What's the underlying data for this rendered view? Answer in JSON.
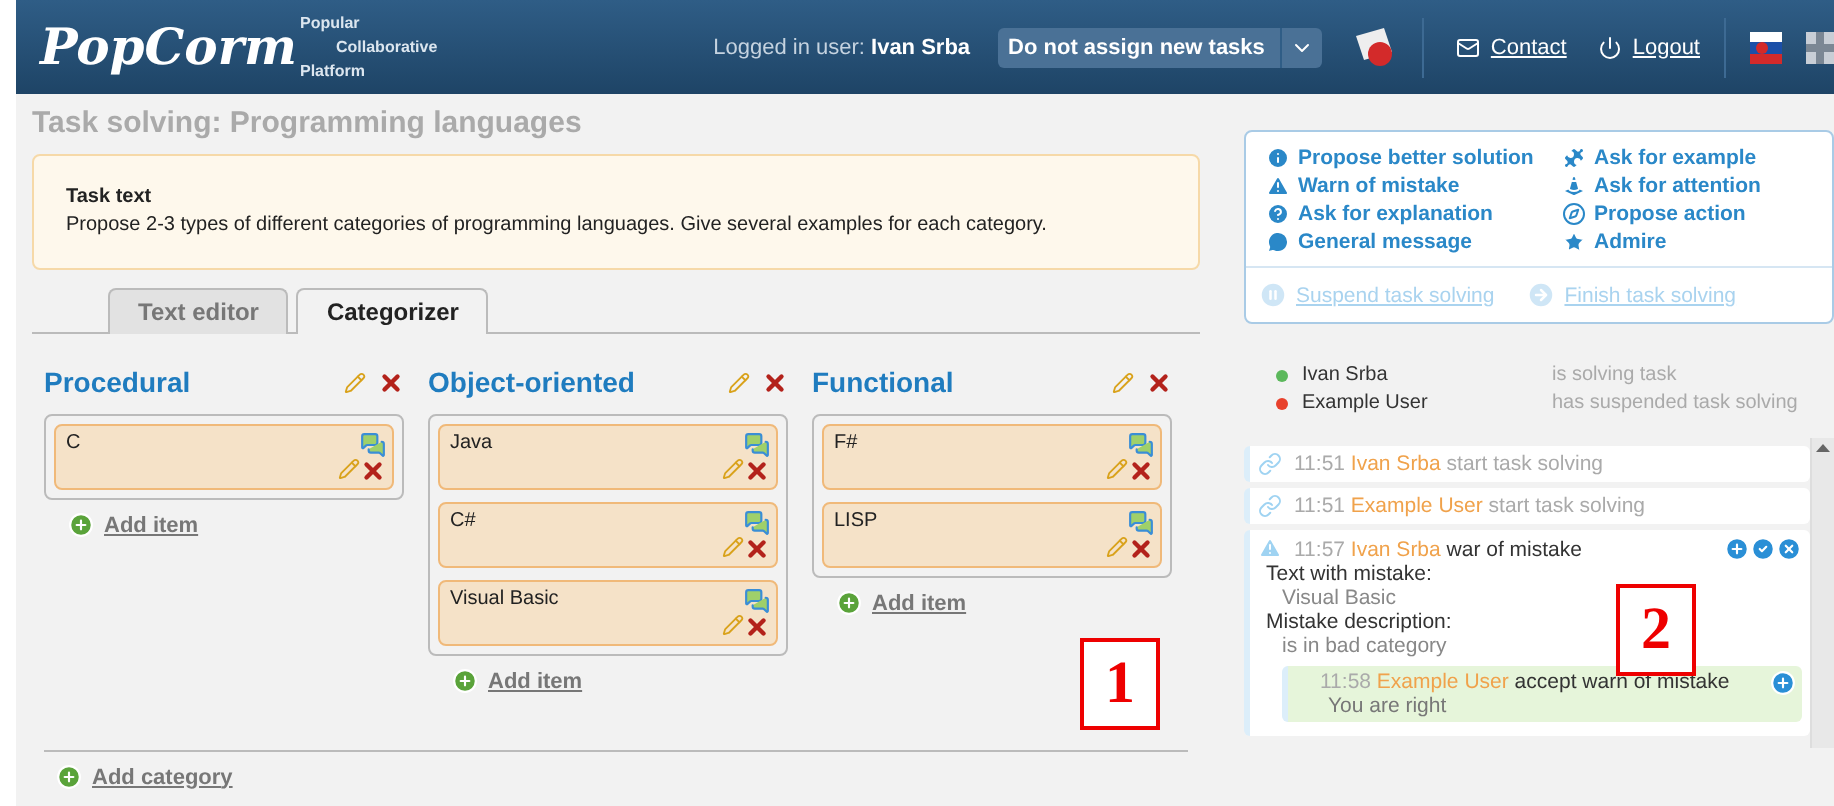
{
  "header": {
    "logo": "PopCorm",
    "tagline": [
      "Popular",
      "Collaborative",
      "Platform"
    ],
    "login_label": "Logged in user:",
    "user": "Ivan Srba",
    "mode_select": {
      "value": "Do not assign new tasks"
    },
    "links": [
      {
        "kind": "contact",
        "label": "Contact"
      },
      {
        "kind": "logout",
        "label": "Logout"
      }
    ]
  },
  "page_title": "Task solving: Programming languages",
  "task": {
    "heading": "Task text",
    "text": "Propose 2-3 types of different categories of programming languages. Give several examples for each category."
  },
  "tabs": [
    {
      "label": "Text editor",
      "selected": false
    },
    {
      "label": "Categorizer",
      "selected": true
    }
  ],
  "categories": [
    {
      "name": "Procedural",
      "items": [
        "C"
      ],
      "add_label": "Add item"
    },
    {
      "name": "Object-oriented",
      "items": [
        "Java",
        "C#",
        "Visual Basic"
      ],
      "add_label": "Add item"
    },
    {
      "name": "Functional",
      "items": [
        "F#",
        "LISP"
      ],
      "add_label": "Add item"
    }
  ],
  "add_category": "Add category",
  "actions": [
    {
      "kind": "info",
      "label": "Propose better solution"
    },
    {
      "kind": "example",
      "label": "Ask for example"
    },
    {
      "kind": "warning",
      "label": "Warn of mistake"
    },
    {
      "kind": "attention",
      "label": "Ask for attention"
    },
    {
      "kind": "question",
      "label": "Ask for explanation"
    },
    {
      "kind": "action",
      "label": "Propose action"
    },
    {
      "kind": "message",
      "label": "General message"
    },
    {
      "kind": "admire",
      "label": "Admire"
    }
  ],
  "task_controls": [
    {
      "kind": "suspend",
      "label": "Suspend task solving",
      "disabled": true
    },
    {
      "kind": "finish",
      "label": "Finish task solving",
      "disabled": true
    }
  ],
  "participants": [
    {
      "name": "Ivan Srba",
      "status": "is solving task",
      "color": "#5cb85c"
    },
    {
      "name": "Example User",
      "status": "has suspended task solving",
      "color": "#e8412c"
    }
  ],
  "log": [
    {
      "kind": "start",
      "time": "11:51",
      "user": "Ivan Srba",
      "text": "start task solving"
    },
    {
      "kind": "start",
      "time": "11:51",
      "user": "Example User",
      "text": "start task solving"
    },
    {
      "kind": "warning",
      "time": "11:57",
      "user": "Ivan Srba",
      "text": "war of mistake",
      "details": [
        {
          "label": "Text with mistake:",
          "value": "Visual Basic"
        },
        {
          "label": "Mistake description:",
          "value": "is in bad category"
        }
      ],
      "replies": [
        {
          "time": "11:58",
          "user": "Example User",
          "text": "accept warn of mistake",
          "note": "You are right"
        }
      ]
    }
  ],
  "callouts": [
    "1",
    "2"
  ]
}
